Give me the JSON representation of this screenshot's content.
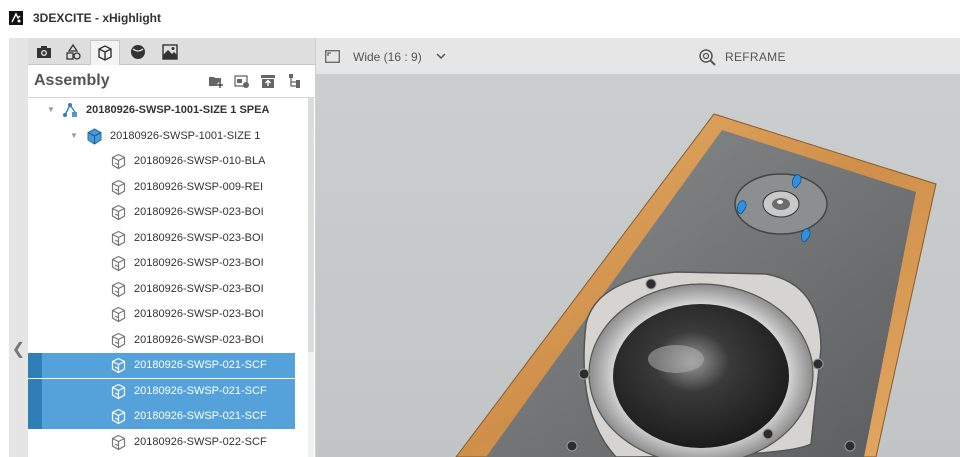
{
  "app": {
    "title": "3DEXCITE - xHighlight"
  },
  "panel": {
    "tabs": [
      {
        "icon": "camera-icon"
      },
      {
        "icon": "shapes-icon"
      },
      {
        "icon": "cube-icon",
        "active": true
      },
      {
        "icon": "material-sphere-icon"
      },
      {
        "icon": "environment-icon"
      }
    ],
    "title": "Assembly",
    "header_icons": [
      "add-group-icon",
      "add-variant-icon",
      "import-icon",
      "tree-structure-icon"
    ]
  },
  "tree": {
    "rows": [
      {
        "label": "20180926-SWSP-1001-SIZE 1 SPEA",
        "bold": true,
        "icon": "assembly-root-icon",
        "expanded": true
      },
      {
        "label": "20180926-SWSP-1001-SIZE 1",
        "icon": "blue-cube-icon",
        "expanded": true
      },
      {
        "label": "20180926-SWSP-010-BLA",
        "icon": "part-icon"
      },
      {
        "label": "20180926-SWSP-009-REI",
        "icon": "part-icon"
      },
      {
        "label": "20180926-SWSP-023-BOI",
        "icon": "part-icon"
      },
      {
        "label": "20180926-SWSP-023-BOI",
        "icon": "part-icon"
      },
      {
        "label": "20180926-SWSP-023-BOI",
        "icon": "part-icon"
      },
      {
        "label": "20180926-SWSP-023-BOI",
        "icon": "part-icon"
      },
      {
        "label": "20180926-SWSP-023-BOI",
        "icon": "part-icon"
      },
      {
        "label": "20180926-SWSP-023-BOI",
        "icon": "part-icon"
      },
      {
        "label": "20180926-SWSP-021-SCF",
        "icon": "part-icon",
        "selected": true
      },
      {
        "label": "20180926-SWSP-021-SCF",
        "icon": "part-icon",
        "selected": true
      },
      {
        "label": "20180926-SWSP-021-SCF",
        "icon": "part-icon",
        "selected": true
      },
      {
        "label": "20180926-SWSP-022-SCF",
        "icon": "part-icon"
      }
    ]
  },
  "viewport": {
    "aspect_label": "Wide (16 : 9)",
    "reframe_label": "REFRAME"
  },
  "colors": {
    "selection": "#55a2da",
    "selection_marker": "#2e7eb8",
    "wood": "#d79a55",
    "baffle": "#6e7070",
    "pin": "#2f8fe0"
  }
}
